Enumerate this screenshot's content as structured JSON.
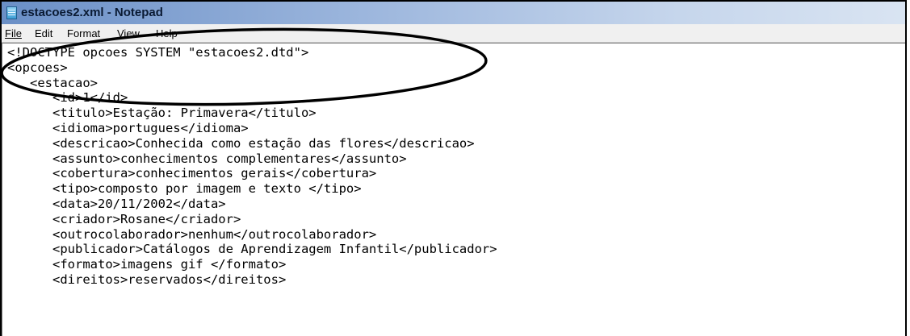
{
  "window": {
    "title": "estacoes2.xml - Notepad",
    "icon": "notepad-icon",
    "accent_color": "#6a8fc6"
  },
  "menu": {
    "file": "File",
    "edit": "Edit",
    "format": "Format",
    "view": "View",
    "help": "Help"
  },
  "editor": {
    "lines": [
      "<!DOCTYPE opcoes SYSTEM \"estacoes2.dtd\">",
      "<opcoes>",
      "   <estacao>",
      "      <id>1</id>",
      "      <titulo>Estação: Primavera</titulo>",
      "      <idioma>portugues</idioma>",
      "      <descricao>Conhecida como estação das flores</descricao>",
      "      <assunto>conhecimentos complementares</assunto>",
      "      <cobertura>conhecimentos gerais</cobertura>",
      "      <tipo>composto por imagem e texto </tipo>",
      "      <data>20/11/2002</data>",
      "      <criador>Rosane</criador>",
      "      <outrocolaborador>nenhum</outrocolaborador>",
      "      <publicador>Catálogos de Aprendizagem Infantil</publicador>",
      "      <formato>imagens gif </formato>",
      "      <direitos>reservados</direitos>"
    ]
  },
  "annotation": {
    "shape": "ellipse",
    "color": "#000000"
  }
}
